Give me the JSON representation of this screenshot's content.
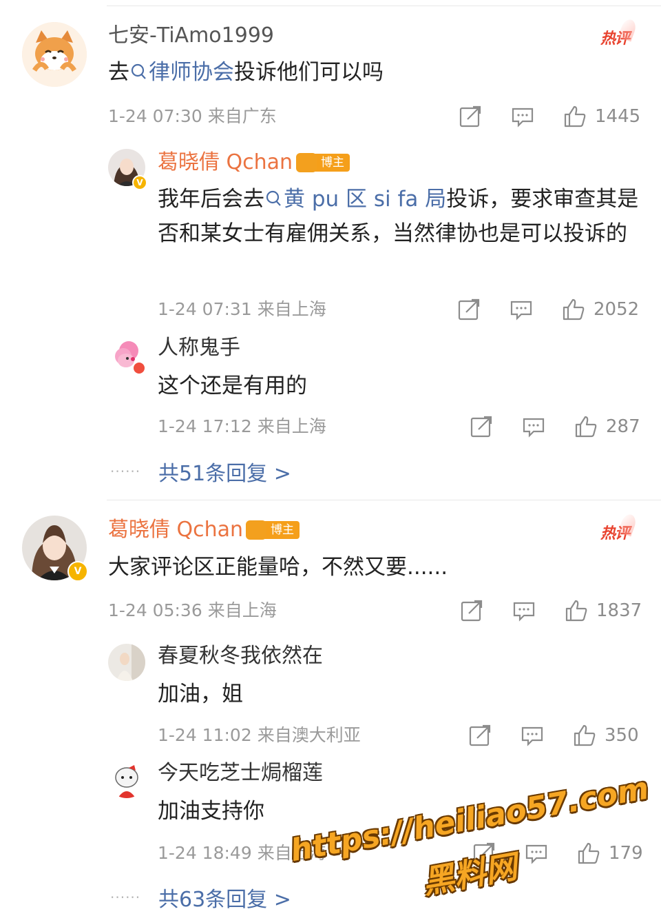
{
  "comments": [
    {
      "user": "七安-TiAmo1999",
      "text_prefix": "去",
      "text_link": "律师协会",
      "text_suffix": "投诉他们可以吗",
      "hot_label": "热评",
      "time": "1-24 07:30",
      "location": "来自广东",
      "likes": "1445",
      "replies": [
        {
          "user": "葛晓倩 Qchan",
          "blogger_label": "博主",
          "text_prefix": "我年后会去",
          "text_link": "黄 pu 区 si fa 局",
          "text_suffix": "投诉，要求审查其是否和某女士有雇佣关系，当然律协也是可以投诉的",
          "time": "1-24 07:31",
          "location": "来自上海",
          "likes": "2052"
        },
        {
          "user": "人称鬼手",
          "text": "这个还是有用的",
          "time": "1-24 17:12",
          "location": "来自上海",
          "likes": "287"
        }
      ],
      "more_replies": "共51条回复 >",
      "dots": "······"
    },
    {
      "user": "葛晓倩 Qchan",
      "blogger_label": "博主",
      "text": "大家评论区正能量哈，不然又要......",
      "hot_label": "热评",
      "time": "1-24 05:36",
      "location": "来自上海",
      "likes": "1837",
      "replies": [
        {
          "user": "春夏秋冬我依然在",
          "text": "加油，姐",
          "time": "1-24 11:02",
          "location": "来自澳大利亚",
          "likes": "350"
        },
        {
          "user": "今天吃芝士焗榴莲",
          "text": "加油支持你",
          "time": "1-24 18:49",
          "location": "来自上海",
          "likes": "179"
        }
      ],
      "more_replies": "共63条回复 >",
      "dots": "······"
    }
  ],
  "verified_mark": "V",
  "watermark": {
    "url": "https://heiliao57.com",
    "name": "黑料网"
  },
  "colors": {
    "link": "#4b6ea8",
    "blogger_name": "#eb7340",
    "hot": "#e8432f",
    "meta": "#9a9a9a"
  },
  "icons": [
    "search-icon",
    "share-icon",
    "comment-icon",
    "like-icon"
  ]
}
